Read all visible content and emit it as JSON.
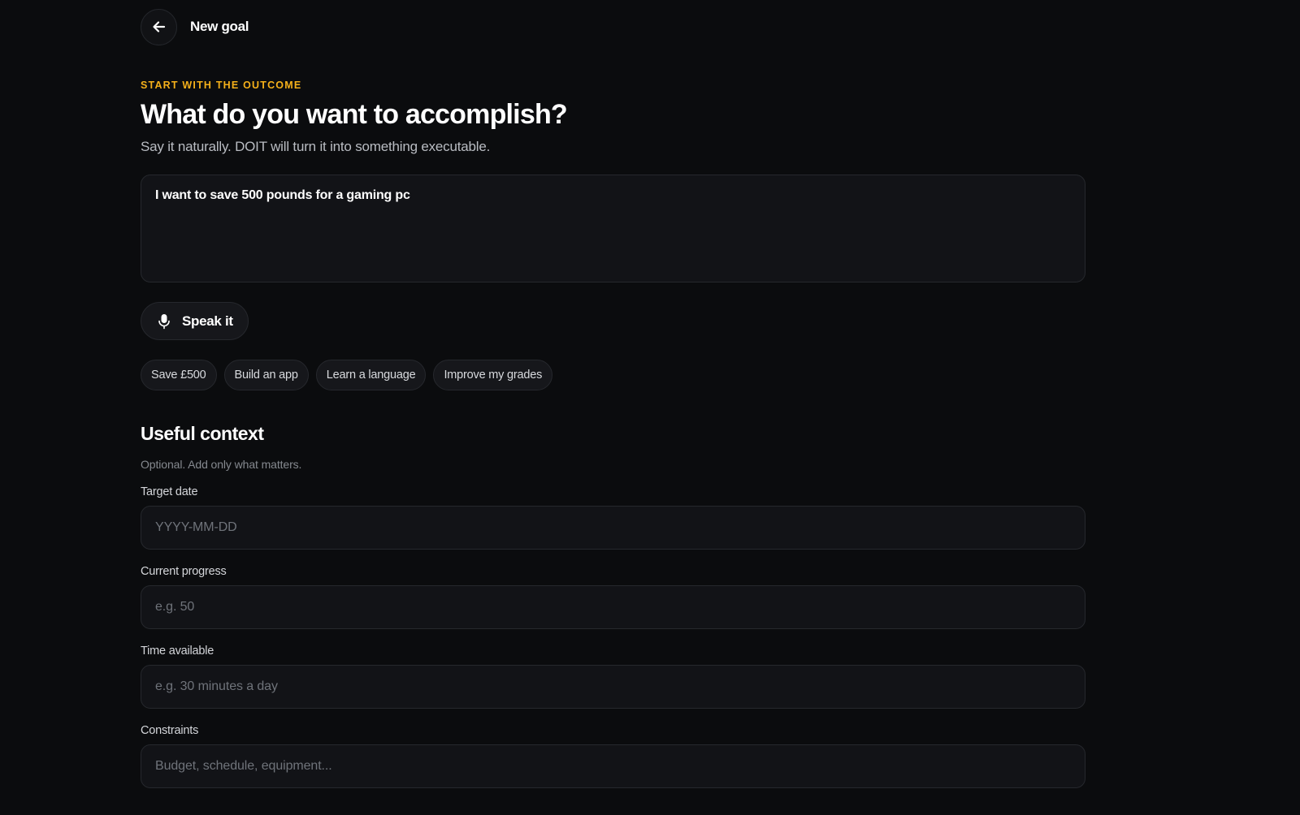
{
  "header": {
    "title": "New goal"
  },
  "hero": {
    "eyebrow": "START WITH THE OUTCOME",
    "title": "What do you want to accomplish?",
    "subtitle": "Say it naturally. DOIT will turn it into something executable."
  },
  "goal_input": {
    "value": "I want to save 500 pounds for a gaming pc"
  },
  "speak_button": {
    "label": "Speak it"
  },
  "suggestions": [
    "Save £500",
    "Build an app",
    "Learn a language",
    "Improve my grades"
  ],
  "context": {
    "title": "Useful context",
    "subtitle": "Optional. Add only what matters.",
    "fields": [
      {
        "label": "Target date",
        "placeholder": "YYYY-MM-DD"
      },
      {
        "label": "Current progress",
        "placeholder": "e.g. 50"
      },
      {
        "label": "Time available",
        "placeholder": "e.g. 30 minutes a day"
      },
      {
        "label": "Constraints",
        "placeholder": "Budget, schedule, equipment..."
      }
    ]
  },
  "colors": {
    "background": "#0b0c0e",
    "accent": "#f5b01a",
    "surface": "#121317",
    "border": "#26282d"
  }
}
